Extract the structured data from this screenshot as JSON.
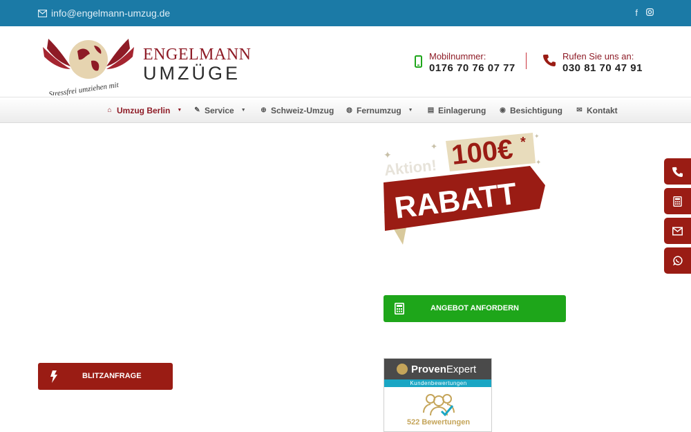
{
  "topbar": {
    "email": "info@engelmann-umzug.de",
    "social": [
      {
        "icon": "facebook-icon",
        "glyph": "f"
      },
      {
        "icon": "instagram-icon",
        "glyph": "◘"
      }
    ]
  },
  "logo": {
    "line1": "ENGELMANN",
    "line2": "UMZÜGE",
    "tagline": "Stressfrei umziehen mit"
  },
  "contacts": {
    "mobile": {
      "label": "Mobilnummer:",
      "number": "0176 70 76 07 77",
      "icon": "smartphone-icon"
    },
    "phone": {
      "label": "Rufen Sie uns an:",
      "number": "030 81 70 47 91",
      "icon": "phone-icon"
    }
  },
  "nav": {
    "items": [
      {
        "label": "Umzug Berlin",
        "icon": "home-icon",
        "active": true,
        "dropdown": true
      },
      {
        "label": "Service",
        "icon": "wrench-icon",
        "dropdown": true
      },
      {
        "label": "Schweiz-Umzug",
        "icon": "plus-circle-icon"
      },
      {
        "label": "Fernumzug",
        "icon": "globe-icon",
        "dropdown": true
      },
      {
        "label": "Einlagerung",
        "icon": "truck-icon"
      },
      {
        "label": "Besichtigung",
        "icon": "eye-icon"
      },
      {
        "label": "Kontakt",
        "icon": "envelope-icon"
      }
    ]
  },
  "promo": {
    "label": "Aktion!",
    "amount": "100€",
    "asterisk": "*",
    "word": "RABATT"
  },
  "buttons": {
    "offer": "ANGEBOT ANFORDERN",
    "blitz": "BLITZANFRAGE"
  },
  "provenexpert": {
    "brand_bold": "Proven",
    "brand_light": "Expert",
    "subtitle": "Kundenbewertungen",
    "count": "522 Bewertungen"
  },
  "side_buttons": [
    "phone-icon",
    "calculator-icon",
    "envelope-icon",
    "whatsapp-icon"
  ],
  "colors": {
    "topbar": "#1b7aa6",
    "brand_red": "#8e1b26",
    "button_red": "#9a1c14",
    "button_green": "#1ea61a",
    "gold": "#c5a55a"
  }
}
